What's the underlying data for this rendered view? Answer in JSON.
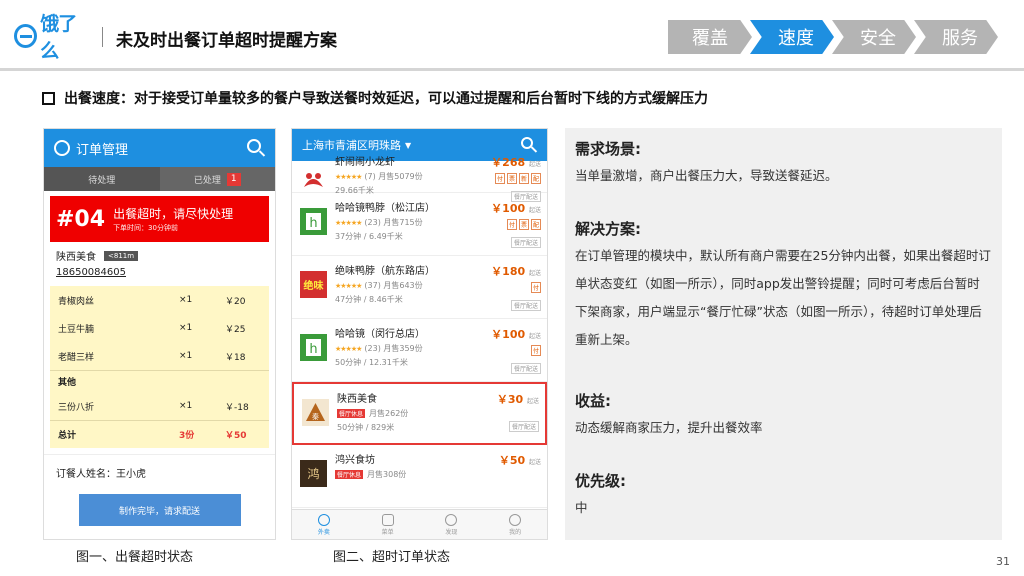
{
  "header": {
    "logo_text": "饿了么",
    "title": "未及时出餐订单超时提醒方案",
    "nav": [
      {
        "label": "覆盖",
        "active": false
      },
      {
        "label": "速度",
        "active": true
      },
      {
        "label": "安全",
        "active": false
      },
      {
        "label": "服务",
        "active": false
      }
    ],
    "accent_color": "#1e8fe0"
  },
  "subtitle": "出餐速度：对于接受订单量较多的餐户导致送餐时效延迟，可以通过提醒和后台暂时下线的方式缓解压力",
  "phone1": {
    "title": "订单管理",
    "tabs": [
      "待处理",
      "已处理"
    ],
    "badge": "1",
    "alert": {
      "number": "#04",
      "main": "出餐超时，请尽快处理",
      "sub": "下单时间：30分钟前"
    },
    "customer": {
      "name": "陕西美食",
      "distance": "<811m",
      "phone": "18650084605"
    },
    "items": [
      {
        "name": "青椒肉丝",
        "qty": "×1",
        "price": "￥20"
      },
      {
        "name": "土豆牛腩",
        "qty": "×1",
        "price": "￥25"
      },
      {
        "name": "老醋三样",
        "qty": "×1",
        "price": "￥18"
      }
    ],
    "other_label": "其他",
    "discount": {
      "name": "三份八折",
      "qty": "×1",
      "price": "￥-18"
    },
    "total": {
      "name": "总计",
      "qty": "3份",
      "price": "￥50"
    },
    "orderer": "订餐人姓名：王小虎",
    "button": "制作完毕，请求配送",
    "caption": "图一、出餐超时状态"
  },
  "phone2": {
    "location": "上海市青浦区明珠路",
    "shops": [
      {
        "name": "虾闹闹小龙虾",
        "rating": "(7)",
        "sales": "月售5079份",
        "dist": "29.66千米",
        "price": "￥268",
        "tags": [
          "付",
          "票",
          "新",
          "配"
        ],
        "busy": false
      },
      {
        "name": "哈哈镜鸭脖（松江店）",
        "rating": "(23)",
        "sales": "月售715份",
        "dist": "37分钟 / 6.49千米",
        "price": "￥100",
        "tags": [
          "付",
          "票",
          "配"
        ],
        "busy": false
      },
      {
        "name": "绝味鸭脖（航东路店）",
        "rating": "(37)",
        "sales": "月售643份",
        "dist": "47分钟 / 8.46千米",
        "price": "￥180",
        "tags": [
          "付"
        ],
        "busy": false
      },
      {
        "name": "哈哈镜（闵行总店）",
        "rating": "(23)",
        "sales": "月售359份",
        "dist": "50分钟 / 12.31千米",
        "price": "￥100",
        "tags": [
          "付"
        ],
        "busy": false
      },
      {
        "name": "陕西美食",
        "rating": "",
        "sales": "月售262份",
        "dist": "50分钟 / 829米",
        "price": "￥30",
        "tags": [],
        "busy": true
      },
      {
        "name": "鸿兴食坊",
        "rating": "",
        "sales": "月售308份",
        "dist": "",
        "price": "￥50",
        "tags": [],
        "busy": true
      }
    ],
    "price_suffix": "起送",
    "delivery_tag": "餐厅配送",
    "busy_label": "餐厅休息",
    "bottom_nav": [
      "外卖",
      "菜单",
      "发现",
      "我的"
    ],
    "caption": "图二、超时订单状态"
  },
  "info": {
    "h1": "需求场景:",
    "p1": "当单量激增，商户出餐压力大，导致送餐延迟。",
    "h2": "解决方案:",
    "p2": "在订单管理的模块中，默认所有商户需要在25分钟内出餐，如果出餐超时订单状态变红（如图一所示），同时app发出警铃提醒；同时可考虑后台暂时下架商家，用户端显示“餐厅忙碌”状态（如图一所示），待超时订单处理后重新上架。",
    "h3": "收益:",
    "p3": "动态缓解商家压力，提升出餐效率",
    "h4": "优先级:",
    "p4": "中"
  },
  "page_number": "31"
}
